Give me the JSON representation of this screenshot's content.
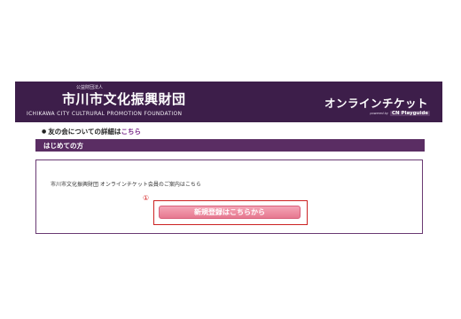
{
  "header": {
    "org_type": "公益財団法人",
    "org_name": "市川市文化振興財団",
    "org_name_en": "ICHIKAWA CITY CULTRURAL PROMOTION FOUNDATION",
    "service_title": "オンラインチケット",
    "powered_label": "powered by",
    "powered_logo": "CN Playguide"
  },
  "member_info": {
    "bullet": "●",
    "text": "友の会についての詳細は",
    "link_label": "こちら"
  },
  "section": {
    "title": "はじめての方"
  },
  "content": {
    "guide_text": "市川市文化振興財団 オンラインチケット会員のご案内はこちら",
    "step_marker": "①",
    "register_button_label": "新規登録はこちらから"
  },
  "colors": {
    "header_bg": "#3d1e4a",
    "section_bar_bg": "#5a2d63",
    "link": "#7a2a8a",
    "button_pink": "#e6788f",
    "highlight_red": "#cc2222"
  }
}
